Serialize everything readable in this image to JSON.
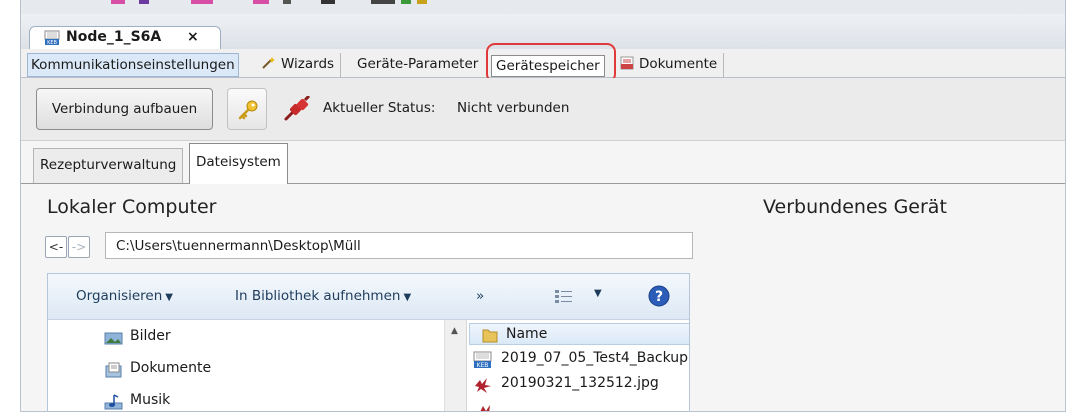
{
  "document_tab": {
    "title": "Node_1_S6A",
    "close": "×"
  },
  "main_tabs": [
    {
      "label": "Kommunikationseinstellungen"
    },
    {
      "label": "Wizards"
    },
    {
      "label": "Geräte-Parameter"
    },
    {
      "label": "Gerätespeicher"
    },
    {
      "label": "Dokumente"
    }
  ],
  "toolbar": {
    "connect_label": "Verbindung aufbauen",
    "status_label": "Aktueller Status:",
    "status_value": "Nicht verbunden"
  },
  "sub_tabs": [
    {
      "label": "Rezepturverwaltung"
    },
    {
      "label": "Dateisystem"
    }
  ],
  "local": {
    "title": "Lokaler Computer",
    "back": "<-",
    "forward": "->",
    "path": "C:\\Users\\tuennermann\\Desktop\\Müll"
  },
  "device": {
    "title": "Verbundenes Gerät"
  },
  "explorer": {
    "organize": "Organisieren",
    "library": "In Bibliothek aufnehmen",
    "more": "»",
    "nav_items": [
      {
        "label": "Bilder",
        "icon": "pictures-library-icon"
      },
      {
        "label": "Dokumente",
        "icon": "documents-library-icon"
      },
      {
        "label": "Musik",
        "icon": "music-library-icon"
      }
    ],
    "name_header": "Name",
    "files": [
      {
        "label": "2019_07_05_Test4_Backup.",
        "icon": "keb-file-icon"
      },
      {
        "label": "20190321_132512.jpg",
        "icon": "image-file-icon"
      }
    ]
  },
  "colors": {
    "highlight": "#e03a3a",
    "active_tab": "#dbe8f7",
    "explorer_link": "#1e3c5c"
  }
}
